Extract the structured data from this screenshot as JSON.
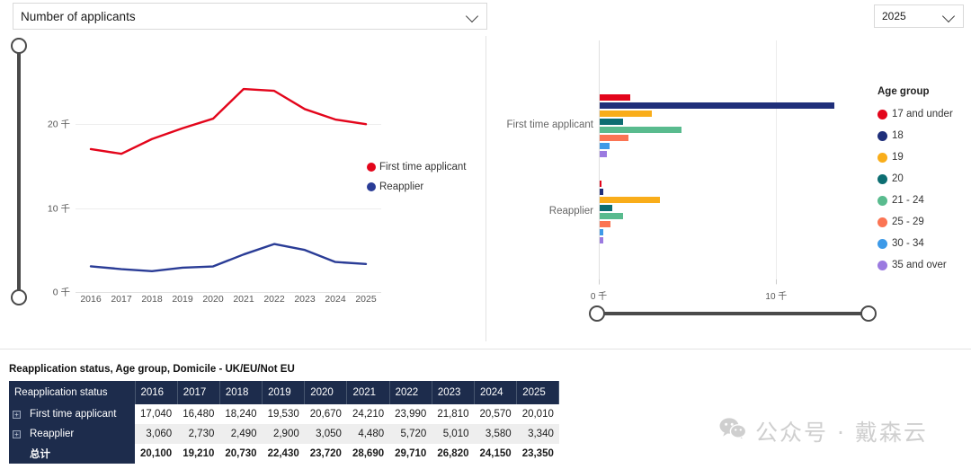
{
  "controls": {
    "measure_dropdown": {
      "value": "Number of applicants",
      "icon": "chevron-down-icon"
    },
    "year_dropdown": {
      "value": "2025",
      "icon": "chevron-down-icon"
    }
  },
  "line_chart": {
    "legend": [
      {
        "label": "First time applicant",
        "color": "#e3051b"
      },
      {
        "label": "Reapplier",
        "color": "#2a3c96"
      }
    ]
  },
  "bar_chart": {
    "group_labels": [
      "First time applicant",
      "Reapplier"
    ],
    "xticks": [
      "0 千",
      "10 千"
    ]
  },
  "age_legend": {
    "title": "Age group",
    "items": [
      {
        "label": "17 and under",
        "color": "#e3051b"
      },
      {
        "label": "18",
        "color": "#1f2f7a"
      },
      {
        "label": "19",
        "color": "#f9ad1a"
      },
      {
        "label": "20",
        "color": "#0d6e72"
      },
      {
        "label": "21 - 24",
        "color": "#59bb8e"
      },
      {
        "label": "25 - 29",
        "color": "#fb7453"
      },
      {
        "label": "30 - 34",
        "color": "#3d9ae8"
      },
      {
        "label": "35 and over",
        "color": "#9b7ae0"
      }
    ]
  },
  "table": {
    "title": "Reapplication status, Age group, Domicile - UK/EU/Not EU",
    "row_header": "Reapplication status",
    "columns": [
      "2016",
      "2017",
      "2018",
      "2019",
      "2020",
      "2021",
      "2022",
      "2023",
      "2024",
      "2025"
    ],
    "rows": [
      {
        "label": "First time applicant",
        "expandable": true,
        "values": [
          "17,040",
          "16,480",
          "18,240",
          "19,530",
          "20,670",
          "24,210",
          "23,990",
          "21,810",
          "20,570",
          "20,010"
        ]
      },
      {
        "label": "Reapplier",
        "expandable": true,
        "values": [
          "3,060",
          "2,730",
          "2,490",
          "2,900",
          "3,050",
          "4,480",
          "5,720",
          "5,010",
          "3,580",
          "3,340"
        ]
      },
      {
        "label": "总计",
        "expandable": false,
        "values": [
          "20,100",
          "19,210",
          "20,730",
          "22,430",
          "23,720",
          "28,690",
          "29,710",
          "26,820",
          "24,150",
          "23,350"
        ]
      }
    ]
  },
  "watermark": {
    "text": "公众号 · 戴森云",
    "icon": "wechat-icon"
  },
  "chart_data": [
    {
      "type": "line",
      "title": "Number of applicants",
      "xlabel": "",
      "ylabel": "",
      "x": [
        "2016",
        "2017",
        "2018",
        "2019",
        "2020",
        "2021",
        "2022",
        "2023",
        "2024",
        "2025"
      ],
      "ylim": [
        0,
        30000
      ],
      "yticks": [
        0,
        10000,
        20000
      ],
      "ytick_labels": [
        "0 千",
        "10 千",
        "20 千"
      ],
      "grid": true,
      "legend_position": "right",
      "series": [
        {
          "name": "First time applicant",
          "color": "#e3051b",
          "values": [
            17040,
            16480,
            18240,
            19530,
            20670,
            24210,
            23990,
            21810,
            20570,
            20010
          ]
        },
        {
          "name": "Reapplier",
          "color": "#2a3c96",
          "values": [
            3060,
            2730,
            2490,
            2900,
            3050,
            4480,
            5720,
            5010,
            3580,
            3340
          ]
        }
      ]
    },
    {
      "type": "bar",
      "orientation": "horizontal",
      "title": "",
      "xlabel": "",
      "ylabel": "",
      "categories": [
        "First time applicant",
        "Reapplier"
      ],
      "xlim": [
        0,
        15200
      ],
      "xticks": [
        0,
        10000
      ],
      "xtick_labels": [
        "0 千",
        "10 千"
      ],
      "grid": true,
      "legend_position": "right",
      "legend_title": "Age group",
      "series": [
        {
          "name": "17 and under",
          "color": "#e3051b",
          "values": [
            1700,
            90
          ]
        },
        {
          "name": "18",
          "color": "#1f2f7a",
          "values": [
            13200,
            180
          ]
        },
        {
          "name": "19",
          "color": "#f9ad1a",
          "values": [
            2950,
            3400
          ]
        },
        {
          "name": "20",
          "color": "#0d6e72",
          "values": [
            1300,
            700
          ]
        },
        {
          "name": "21 - 24",
          "color": "#59bb8e",
          "values": [
            4600,
            1300
          ]
        },
        {
          "name": "25 - 29",
          "color": "#fb7453",
          "values": [
            1600,
            620
          ]
        },
        {
          "name": "30 - 34",
          "color": "#3d9ae8",
          "values": [
            550,
            200
          ]
        },
        {
          "name": "35 and over",
          "color": "#9b7ae0",
          "values": [
            400,
            180
          ]
        }
      ]
    },
    {
      "type": "table",
      "title": "Reapplication status, Age group, Domicile - UK/EU/Not EU",
      "columns": [
        "Reapplication status",
        "2016",
        "2017",
        "2018",
        "2019",
        "2020",
        "2021",
        "2022",
        "2023",
        "2024",
        "2025"
      ],
      "rows": [
        [
          "First time applicant",
          17040,
          16480,
          18240,
          19530,
          20670,
          24210,
          23990,
          21810,
          20570,
          20010
        ],
        [
          "Reapplier",
          3060,
          2730,
          2490,
          2900,
          3050,
          4480,
          5720,
          5010,
          3580,
          3340
        ],
        [
          "总计",
          20100,
          19210,
          20730,
          22430,
          23720,
          28690,
          29710,
          26820,
          24150,
          23350
        ]
      ]
    }
  ]
}
